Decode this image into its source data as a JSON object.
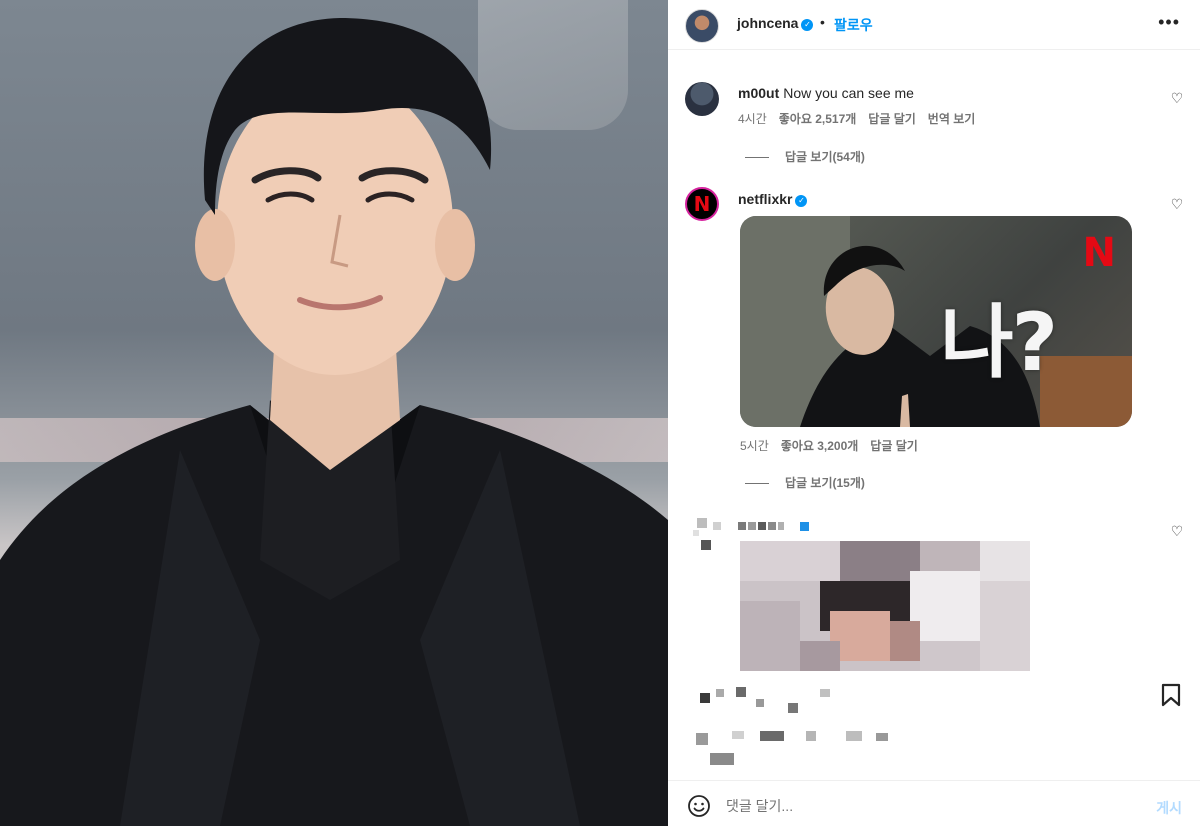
{
  "post": {
    "username": "johncena",
    "verified": true,
    "separator": "•",
    "follow_label": "팔로우",
    "more_icon": "more-horizontal-icon",
    "photo_alt": "man in black suit smiling"
  },
  "comments": [
    {
      "username": "m00ut",
      "text": "Now you can see me",
      "time": "4시간",
      "likes": "좋아요 2,517개",
      "reply_label": "답글 달기",
      "translate_label": "번역 보기",
      "view_replies": "답글 보기(54개)"
    },
    {
      "username": "netflixkr",
      "verified": true,
      "gif_logo": "N",
      "gif_caption": "나?",
      "time": "5시간",
      "likes": "좋아요 3,200개",
      "reply_label": "답글 달기",
      "view_replies": "답글 보기(15개)"
    }
  ],
  "composer": {
    "placeholder": "댓글 달기...",
    "post_label": "게시"
  },
  "colors": {
    "accent": "#0095f6",
    "netflix_red": "#e50914",
    "muted": "#737373",
    "post_disabled": "#b3dbff"
  }
}
